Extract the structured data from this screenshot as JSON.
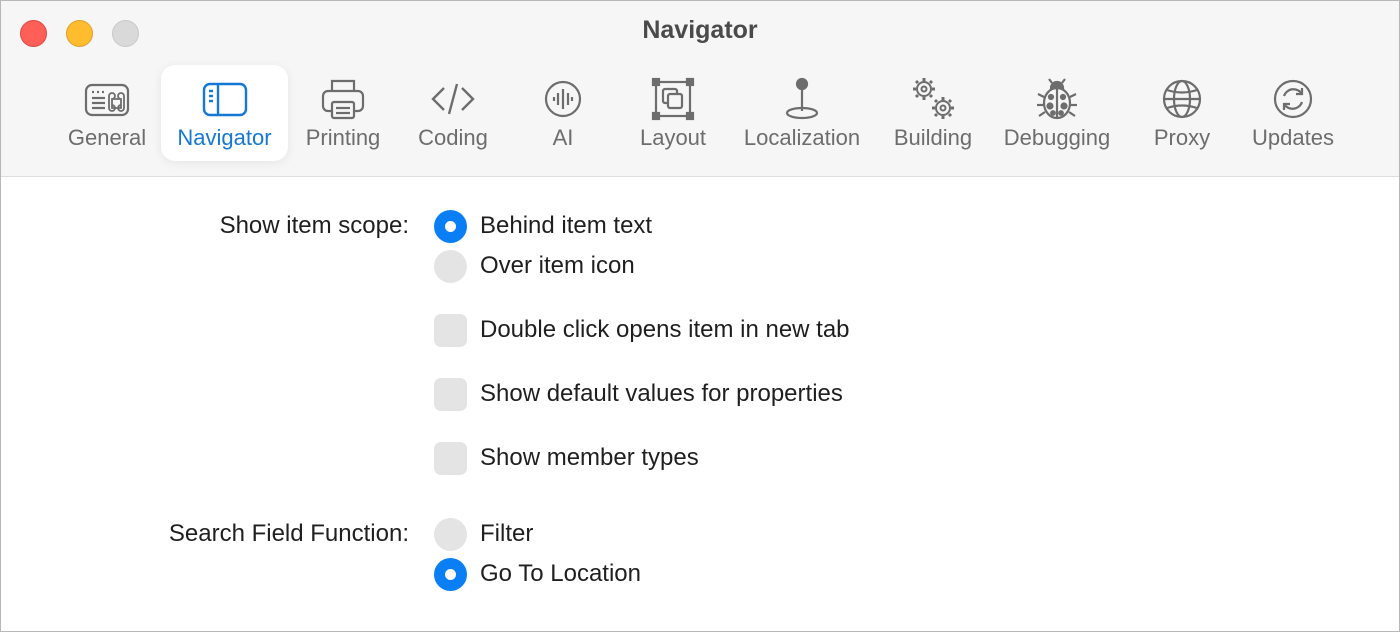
{
  "window": {
    "title": "Navigator"
  },
  "toolbar": {
    "tabs": [
      {
        "label": "General",
        "icon": "keyboard-icon"
      },
      {
        "label": "Navigator",
        "icon": "sidebar-icon",
        "selected": true
      },
      {
        "label": "Printing",
        "icon": "printer-icon"
      },
      {
        "label": "Coding",
        "icon": "code-brackets-icon"
      },
      {
        "label": "AI",
        "icon": "waveform-icon"
      },
      {
        "label": "Layout",
        "icon": "layout-frame-icon"
      },
      {
        "label": "Localization",
        "icon": "location-pin-icon"
      },
      {
        "label": "Building",
        "icon": "gears-icon"
      },
      {
        "label": "Debugging",
        "icon": "ladybug-icon"
      },
      {
        "label": "Proxy",
        "icon": "globe-icon"
      },
      {
        "label": "Updates",
        "icon": "refresh-icon"
      }
    ]
  },
  "settings": {
    "item_scope": {
      "label": "Show item scope:",
      "options": [
        {
          "label": "Behind item text",
          "selected": true
        },
        {
          "label": "Over item icon",
          "selected": false
        }
      ]
    },
    "checkboxes": [
      {
        "label": "Double click opens item in new tab",
        "checked": false
      },
      {
        "label": "Show default values for properties",
        "checked": false
      },
      {
        "label": "Show member types",
        "checked": false
      }
    ],
    "search_field": {
      "label": "Search Field Function:",
      "options": [
        {
          "label": "Filter",
          "selected": false
        },
        {
          "label": "Go To Location",
          "selected": true
        }
      ]
    }
  },
  "colors": {
    "accent": "#0a7ff5",
    "selected_tab_text": "#1478d4",
    "close": "#fe5f57",
    "minimize": "#febc2e",
    "zoom": "#d9d9d9"
  }
}
